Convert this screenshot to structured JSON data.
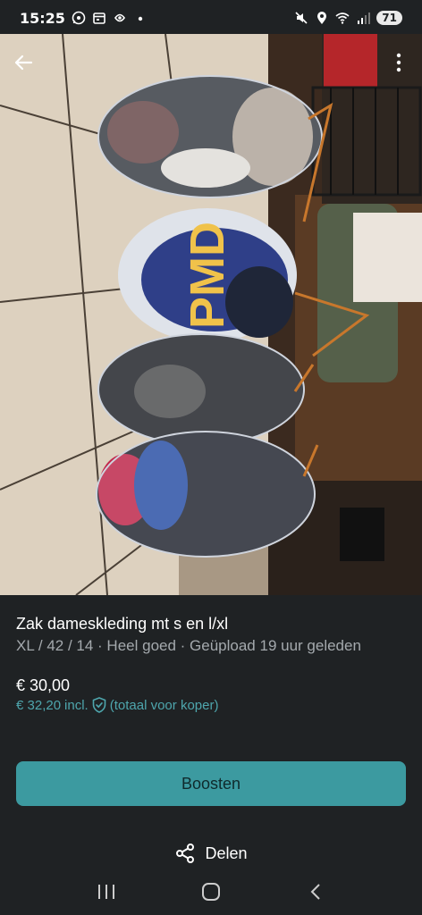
{
  "status_bar": {
    "time": "15:25",
    "battery": "71"
  },
  "listing": {
    "title": "Zak dameskleding mt s en l/xl",
    "meta": "XL / 42 / 14 · Heel goed · Geüpload 19 uur geleden",
    "price": "€ 30,00",
    "price_incl_amount": "€ 32,20",
    "price_incl_label": "incl.",
    "price_incl_note": "(totaal voor koper)"
  },
  "actions": {
    "boost_label": "Boosten",
    "share_label": "Delen"
  },
  "icons": {
    "back": "arrow-left-icon",
    "more": "more-vertical-icon",
    "share": "share-icon",
    "shield": "shield-check-icon"
  },
  "colors": {
    "background": "#1f2224",
    "accent": "#3c9aa0",
    "incl_price": "#4ea6ad"
  }
}
